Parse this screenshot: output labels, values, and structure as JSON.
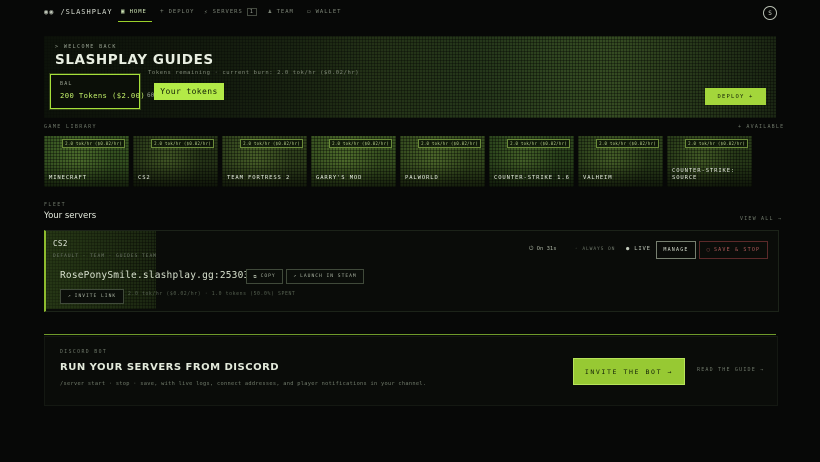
{
  "nav": {
    "brand": "/SLASHPLAY",
    "items": [
      {
        "label": "HOME",
        "icon": "home-icon",
        "badge": null
      },
      {
        "label": "DEPLOY",
        "icon": "plus-icon",
        "badge": null
      },
      {
        "label": "SERVERS",
        "icon": "servers-icon",
        "badge": "1"
      },
      {
        "label": "TEAM",
        "icon": "team-icon",
        "badge": null
      },
      {
        "label": "WALLET",
        "icon": "wallet-icon",
        "badge": null
      }
    ],
    "avatar": "S"
  },
  "hero": {
    "welcome": "> WELCOME BACK",
    "title": "SLASHPLAY GUIDES",
    "subtitle": "Tokens remaining · current burn: 2.0 tok/hr ($0.02/hr)",
    "balance_label": "BAL",
    "balance_value": "200 Tokens ($2.00)",
    "tokens_tag": "Your tokens",
    "mini_text": "60",
    "deploy_label": "DEPLOY +"
  },
  "library": {
    "label": "GAME LIBRARY",
    "available": "+ AVAILABLE",
    "games": [
      {
        "name": "MINECRAFT",
        "chip": "2.0 tok/hr ($0.02/hr)",
        "color": "#3a5a24"
      },
      {
        "name": "CS2",
        "chip": "2.0 tok/hr ($0.02/hr)",
        "color": "#2a3a1a"
      },
      {
        "name": "TEAM FORTRESS 2",
        "chip": "2.0 tok/hr ($0.02/hr)",
        "color": "#34471f"
      },
      {
        "name": "GARRY'S MOD",
        "chip": "2.0 tok/hr ($0.02/hr)",
        "color": "#3e5a24"
      },
      {
        "name": "PALWORLD",
        "chip": "2.0 tok/hr ($0.02/hr)",
        "color": "#3a5222"
      },
      {
        "name": "COUNTER-STRIKE 1.6",
        "chip": "2.0 tok/hr ($0.02/hr)",
        "color": "#2f4a1f"
      },
      {
        "name": "VALHEIM",
        "chip": "2.0 tok/hr ($0.02/hr)",
        "color": "#30461e"
      },
      {
        "name": "COUNTER-STRIKE: SOURCE",
        "chip": "2.0 tok/hr ($0.02/hr)",
        "color": "#2c401b"
      }
    ]
  },
  "fleet": {
    "label": "FLEET",
    "title": "Your servers",
    "view_all": "VIEW ALL →",
    "server": {
      "name": "CS2",
      "meta": "DEFAULT · TEAM · GUIDES TEAM",
      "address": "RosePonySmile.slashplay.gg:25303",
      "copy_label": "COPY",
      "launch_label": "LAUNCH IN STEAM",
      "invite_label": "INVITE LINK",
      "note": "2.0 tok/hr ($0.02/hr) · 1.0 tokens (50.0%) SPENT",
      "uptime": "On 31s",
      "always": "ALWAYS ON",
      "status": "LIVE",
      "manage_label": "MANAGE",
      "stop_label": "SAVE & STOP"
    }
  },
  "discord": {
    "label": "DISCORD BOT",
    "title": "RUN YOUR SERVERS FROM DISCORD",
    "subtitle": "/server start · stop · save, with live logs, connect addresses, and player notifications in your channel.",
    "invite_label": "INVITE THE BOT →",
    "guide_label": "READ THE GUIDE →"
  },
  "colors": {
    "accent": "#a3d63b",
    "background": "#070807",
    "danger": "#b05a5a"
  }
}
